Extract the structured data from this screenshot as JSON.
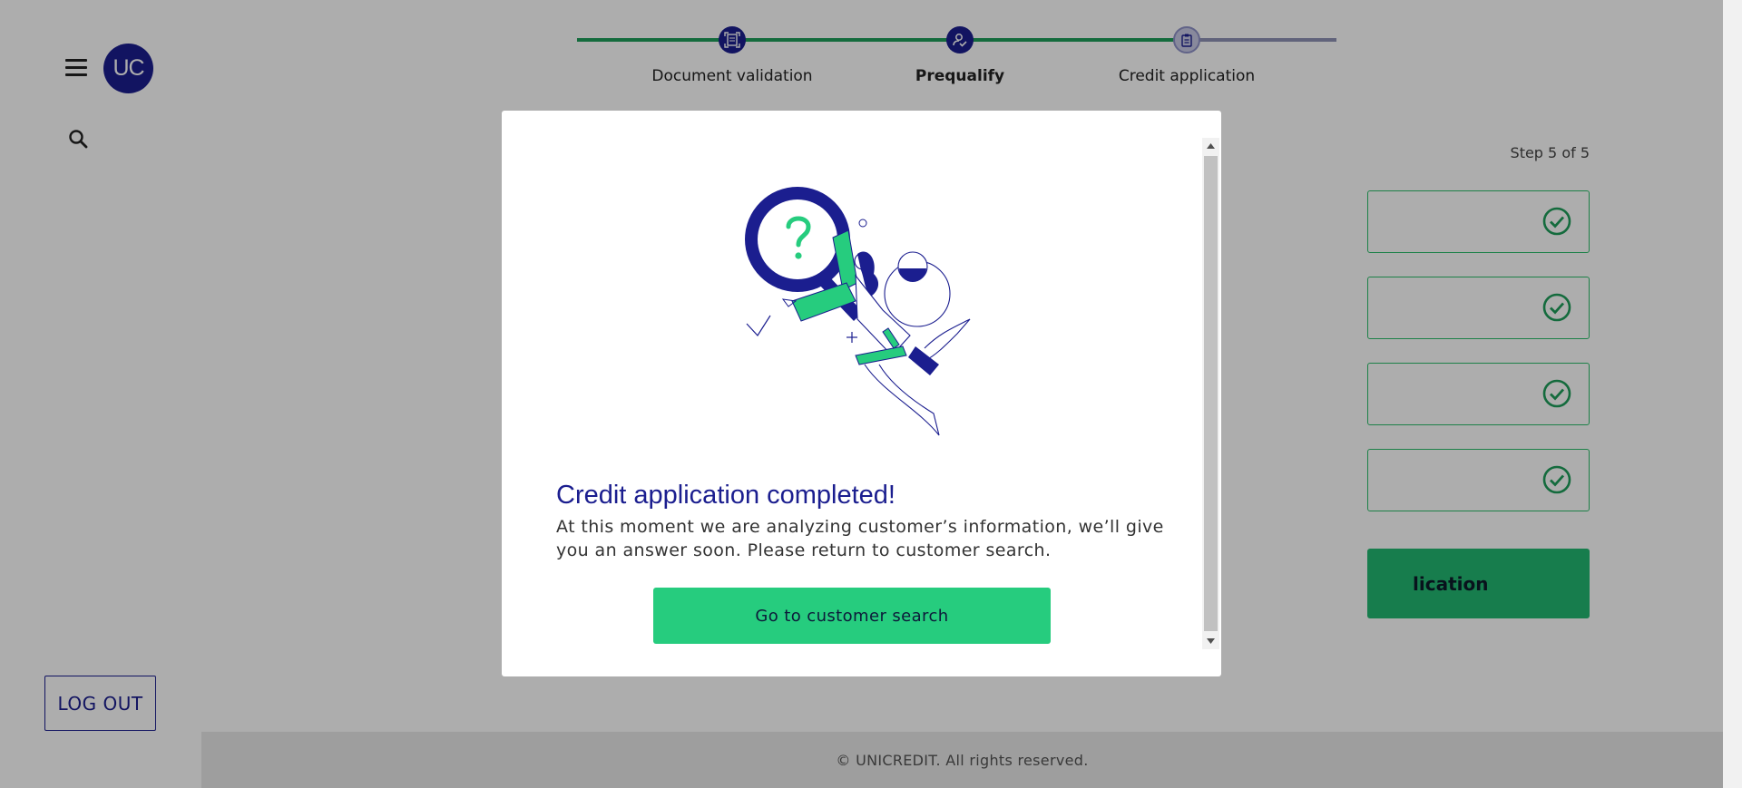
{
  "user": {
    "initials": "UC"
  },
  "sidebar": {
    "logout_label": "LOG OUT"
  },
  "stepper": {
    "steps": [
      {
        "label": "Document validation",
        "state": "done",
        "icon": "document-scan-icon"
      },
      {
        "label": "Prequalify",
        "state": "active",
        "icon": "person-check-icon"
      },
      {
        "label": "Credit application",
        "state": "current",
        "icon": "clipboard-icon"
      }
    ],
    "progress_color": "#1e9e5a",
    "pending_color": "#8f92b5"
  },
  "main": {
    "step_counter": "Step 5 of 5",
    "submit_partial_label": "lication"
  },
  "footer": {
    "copyright": "© UNICREDIT. All rights reserved."
  },
  "modal": {
    "title": "Credit application completed!",
    "message": "At this moment we are analyzing customer’s information, we’ll give you an answer soon. Please return to customer search.",
    "button_label": "Go to customer search"
  },
  "colors": {
    "brand_blue": "#1b1e8f",
    "accent_green": "#26cc7e",
    "card_border_green": "#2bbf6a"
  }
}
